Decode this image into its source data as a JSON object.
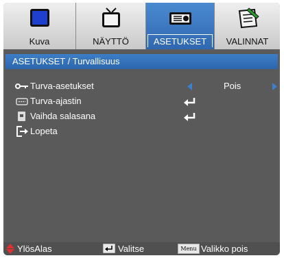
{
  "tabs": [
    {
      "label": "Kuva",
      "icon": "monitor-icon",
      "active": false
    },
    {
      "label": "NÄYTTÖ",
      "icon": "tv-icon",
      "active": false
    },
    {
      "label": "ASETUKSET",
      "icon": "projector-icon",
      "active": true
    },
    {
      "label": "VALINNAT",
      "icon": "checklist-icon",
      "active": false
    }
  ],
  "header": {
    "title": "ASETUKSET / Turvallisuus"
  },
  "rows": [
    {
      "label": "Turva-asetukset",
      "icon": "key-icon",
      "value": "Pois"
    },
    {
      "label": "Turva-ajastin",
      "icon": "timer-icon"
    },
    {
      "label": "Vaihda salasana",
      "icon": "password-icon"
    },
    {
      "label": "Lopeta",
      "icon": "exit-icon"
    }
  ],
  "footer": {
    "nav_label": "YlösAlas",
    "select_label": "Valitse",
    "menu_key": "Menu",
    "menu_label": "Valikko pois"
  },
  "colors": {
    "accent": "#2f68b0",
    "panel": "#5a5a5a",
    "arrow": "#3f7fd0",
    "nav": "#e03030"
  }
}
